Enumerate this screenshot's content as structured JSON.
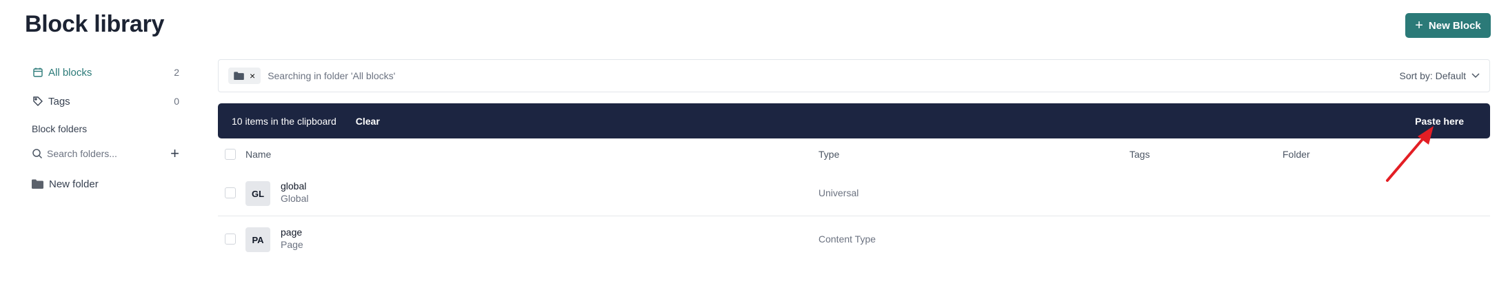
{
  "header": {
    "title": "Block library",
    "new_block_label": "New Block"
  },
  "sidebar": {
    "all_blocks": {
      "label": "All blocks",
      "count": "2"
    },
    "tags": {
      "label": "Tags",
      "count": "0"
    },
    "folders_heading": "Block folders",
    "folder_search_placeholder": "Search folders...",
    "folders": [
      {
        "label": "New folder"
      }
    ]
  },
  "search": {
    "chip_remove": "×",
    "text": "Searching in folder 'All blocks'",
    "sort_label": "Sort by: Default"
  },
  "clipboard": {
    "info": "10 items in the clipboard",
    "clear_label": "Clear",
    "paste_label": "Paste here"
  },
  "table": {
    "columns": {
      "name": "Name",
      "type": "Type",
      "tags": "Tags",
      "folder": "Folder"
    },
    "rows": [
      {
        "initials": "GL",
        "name": "global",
        "subtitle": "Global",
        "type": "Universal"
      },
      {
        "initials": "PA",
        "name": "page",
        "subtitle": "Page",
        "type": "Content Type"
      }
    ]
  },
  "colors": {
    "accent": "#2b7a78",
    "banner": "#1c2541",
    "arrow": "#e31e24"
  },
  "icons": [
    "calendar-icon",
    "tag-icon",
    "search-icon",
    "plus-icon",
    "folder-icon",
    "chevron-down-icon",
    "close-icon",
    "red-arrow-annotation"
  ]
}
